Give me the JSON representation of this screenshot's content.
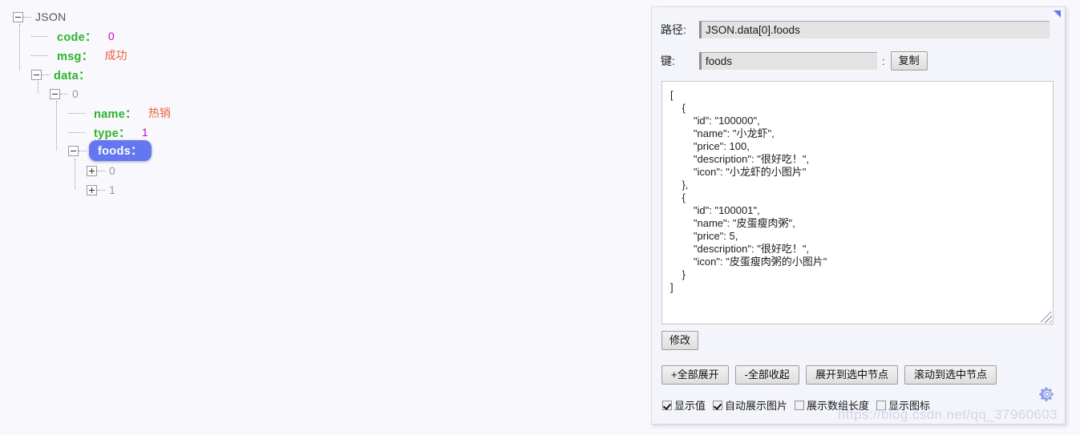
{
  "tree": {
    "root_label": "JSON",
    "nodes": [
      {
        "label": "JSON",
        "value": "",
        "kind": "root",
        "state": "minus"
      },
      {
        "label": "code：",
        "value": "0",
        "kind": "num",
        "state": "leaf"
      },
      {
        "label": "msg：",
        "value": "成功",
        "kind": "str",
        "state": "leaf"
      },
      {
        "label": "data：",
        "value": "",
        "kind": "key",
        "state": "minus"
      },
      {
        "label": "0",
        "value": "",
        "kind": "index",
        "state": "minus"
      },
      {
        "label": "name：",
        "value": "热销",
        "kind": "str",
        "state": "leaf"
      },
      {
        "label": "type：",
        "value": "1",
        "kind": "num",
        "state": "leaf"
      },
      {
        "label": "foods：",
        "value": "",
        "kind": "selected",
        "state": "minus"
      },
      {
        "label": "0",
        "value": "",
        "kind": "index",
        "state": "plus"
      },
      {
        "label": "1",
        "value": "",
        "kind": "index",
        "state": "plus"
      }
    ]
  },
  "panel": {
    "path_label": "路径:",
    "path_value": "JSON.data[0].foods",
    "key_label": "键:",
    "key_value": "foods",
    "key_colon": ":",
    "copy_button": "复制",
    "modify_button": "修改",
    "json_text": "[\n    {\n        \"id\": \"100000\",\n        \"name\": \"小龙虾\",\n        \"price\": 100,\n        \"description\": \"很好吃！\",\n        \"icon\": \"小龙虾的小图片\"\n    },\n    {\n        \"id\": \"100001\",\n        \"name\": \"皮蛋瘦肉粥\",\n        \"price\": 5,\n        \"description\": \"很好吃！\",\n        \"icon\": \"皮蛋瘦肉粥的小图片\"\n    }\n]",
    "actions": [
      {
        "label": "+全部展开"
      },
      {
        "label": "-全部收起"
      },
      {
        "label": "展开到选中节点"
      },
      {
        "label": "滚动到选中节点"
      }
    ],
    "checkboxes": [
      {
        "label": "显示值",
        "checked": true
      },
      {
        "label": "自动展示图片",
        "checked": true
      },
      {
        "label": "展示数组长度",
        "checked": false
      },
      {
        "label": "显示图标",
        "checked": false
      }
    ],
    "gear_icon": "gear-icon",
    "collapse_icon": "collapse-triangle-icon"
  },
  "watermark": "https://blog.csdn.net/qq_37960603",
  "colors": {
    "key_green": "#2bb32b",
    "number_magenta": "#cc00cc",
    "string_orange": "#e9603c",
    "selection_blue": "#6378f0",
    "panel_bg": "#f4f5fb",
    "page_bg": "#f9f9fd"
  }
}
